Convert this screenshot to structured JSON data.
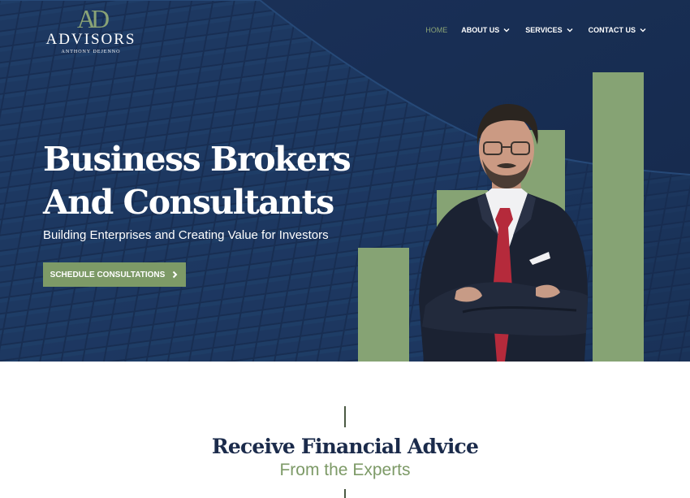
{
  "brand": {
    "monogram": "AD",
    "name": "ADVISORS",
    "tagline": "ANTHONY DEJENNO",
    "accent_color": "#7d9a67",
    "navy_color": "#1b3156"
  },
  "nav": {
    "items": [
      {
        "label": "HOME",
        "active": true,
        "has_dropdown": false
      },
      {
        "label": "ABOUT US",
        "active": false,
        "has_dropdown": true
      },
      {
        "label": "SERVICES",
        "active": false,
        "has_dropdown": true
      },
      {
        "label": "CONTACT US",
        "active": false,
        "has_dropdown": true
      }
    ],
    "dropdown_icon": "chevron-down-icon"
  },
  "hero": {
    "title_line1": "Business Brokers",
    "title_line2": "And Consultants",
    "subtitle": "Building Enterprises and Creating Value for Investors",
    "cta_label": "SCHEDULE CONSULTATIONS",
    "cta_icon": "chevron-right-icon"
  },
  "section": {
    "title": "Receive Financial Advice",
    "subtitle": "From the Experts"
  }
}
